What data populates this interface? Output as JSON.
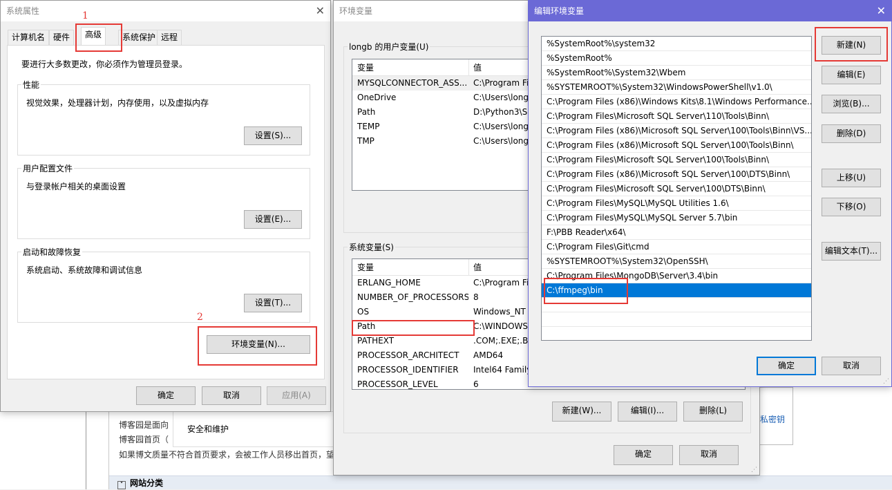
{
  "background_page": {
    "lines": [
      "博客园是面向",
      "博客园首页（",
      "如果博文质量不符合首页要求，会被工作人员移出首页，望"
    ],
    "control_panel_item": "安全和维护",
    "right_link": "私密钥",
    "category_bar": "网站分类"
  },
  "sysprops": {
    "title": "系统属性",
    "tabs": [
      "计算机名",
      "硬件",
      "高级",
      "系统保护",
      "远程"
    ],
    "active_tab": "高级",
    "admin_note": "要进行大多数更改，你必须作为管理员登录。",
    "performance": {
      "label": "性能",
      "desc": "视觉效果，处理器计划，内存使用，以及虚拟内存",
      "button": "设置(S)..."
    },
    "profile": {
      "label": "用户配置文件",
      "desc": "与登录帐户相关的桌面设置",
      "button": "设置(E)..."
    },
    "startup": {
      "label": "启动和故障恢复",
      "desc": "系统启动、系统故障和调试信息",
      "button": "设置(T)..."
    },
    "env_button": "环境变量(N)...",
    "ok": "确定",
    "cancel": "取消",
    "apply": "应用(A)"
  },
  "envvars": {
    "title": "环境变量",
    "user_group": "longb 的用户变量(U)",
    "system_group": "系统变量(S)",
    "col_var": "变量",
    "col_val": "值",
    "user_rows": [
      {
        "name": "MYSQLCONNECTOR_ASS...",
        "value": "C:\\Program Fi"
      },
      {
        "name": "OneDrive",
        "value": "C:\\Users\\long"
      },
      {
        "name": "Path",
        "value": "D:\\Python3\\Sc"
      },
      {
        "name": "TEMP",
        "value": "C:\\Users\\long"
      },
      {
        "name": "TMP",
        "value": "C:\\Users\\long"
      }
    ],
    "system_rows": [
      {
        "name": "ERLANG_HOME",
        "value": "C:\\Program Fi"
      },
      {
        "name": "NUMBER_OF_PROCESSORS",
        "value": "8"
      },
      {
        "name": "OS",
        "value": "Windows_NT"
      },
      {
        "name": "Path",
        "value": "C:\\WINDOWS"
      },
      {
        "name": "PATHEXT",
        "value": ".COM;.EXE;.BA"
      },
      {
        "name": "PROCESSOR_ARCHITECT",
        "value": "AMD64"
      },
      {
        "name": "PROCESSOR_IDENTIFIER",
        "value": "Intel64 Family"
      },
      {
        "name": "PROCESSOR_LEVEL",
        "value": "6"
      }
    ],
    "new_button": "新建(W)...",
    "edit_button": "编辑(I)...",
    "delete_button": "删除(L)",
    "ok": "确定",
    "cancel": "取消"
  },
  "editenv": {
    "title": "编辑环境变量",
    "paths": [
      "%SystemRoot%\\system32",
      "%SystemRoot%",
      "%SystemRoot%\\System32\\Wbem",
      "%SYSTEMROOT%\\System32\\WindowsPowerShell\\v1.0\\",
      "C:\\Program Files (x86)\\Windows Kits\\8.1\\Windows Performance...",
      "C:\\Program Files\\Microsoft SQL Server\\110\\Tools\\Binn\\",
      "C:\\Program Files (x86)\\Microsoft SQL Server\\100\\Tools\\Binn\\VS...",
      "C:\\Program Files (x86)\\Microsoft SQL Server\\100\\Tools\\Binn\\",
      "C:\\Program Files\\Microsoft SQL Server\\100\\Tools\\Binn\\",
      "C:\\Program Files (x86)\\Microsoft SQL Server\\100\\DTS\\Binn\\",
      "C:\\Program Files\\Microsoft SQL Server\\100\\DTS\\Binn\\",
      "C:\\Program Files\\MySQL\\MySQL Utilities 1.6\\",
      "C:\\Program Files\\MySQL\\MySQL Server 5.7\\bin",
      "F:\\PBB Reader\\x64\\",
      "C:\\Program Files\\Git\\cmd",
      "%SYSTEMROOT%\\System32\\OpenSSH\\",
      "C:\\Program Files\\MongoDB\\Server\\3.4\\bin",
      "C:\\ffmpeg\\bin"
    ],
    "selected_index": 17,
    "buttons": {
      "new": "新建(N)",
      "edit": "编辑(E)",
      "browse": "浏览(B)...",
      "delete": "删除(D)",
      "up": "上移(U)",
      "down": "下移(O)",
      "edit_text": "编辑文本(T)..."
    },
    "ok": "确定",
    "cancel": "取消"
  },
  "annotations": {
    "step1": "1",
    "step2": "2"
  },
  "colors": {
    "accent": "#0078d7",
    "edit_title": "#6b69d6",
    "annotation": "#e53935"
  }
}
